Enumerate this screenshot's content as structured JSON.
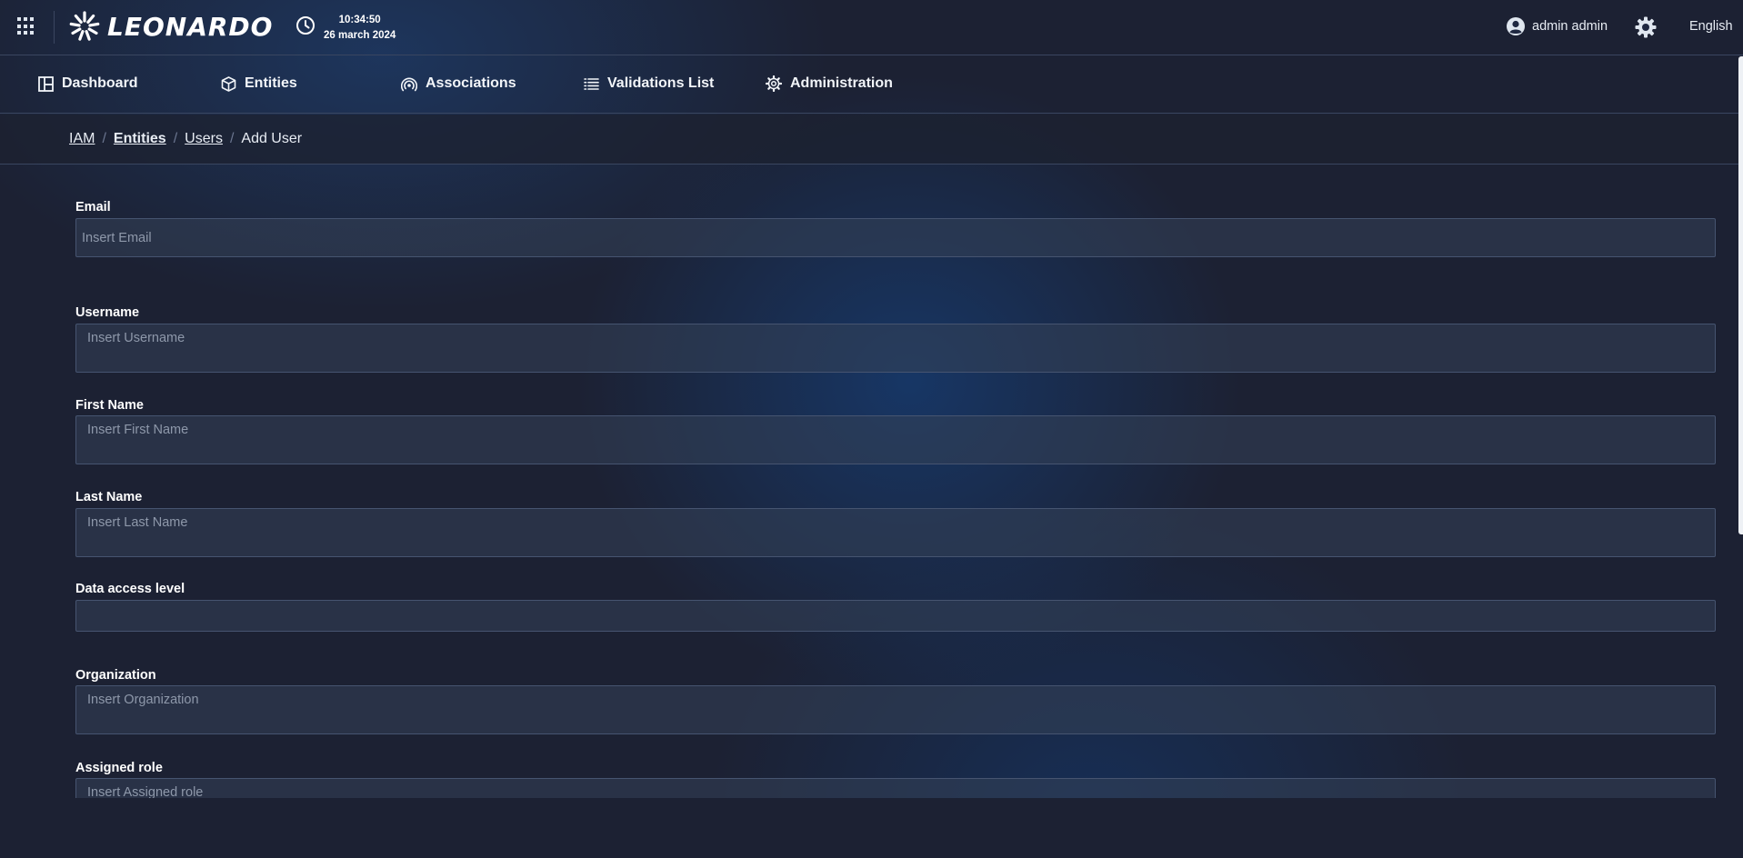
{
  "header": {
    "logo_text": "LEONARDO",
    "time": "10:34:50",
    "date": "26 march 2024",
    "user_name": "admin admin",
    "language": "English"
  },
  "nav": {
    "items": [
      {
        "label": "Dashboard",
        "icon": "dashboard-icon"
      },
      {
        "label": "Entities",
        "icon": "cube-icon"
      },
      {
        "label": "Associations",
        "icon": "broadcast-icon"
      },
      {
        "label": "Validations List",
        "icon": "list-icon"
      },
      {
        "label": "Administration",
        "icon": "gear-icon"
      }
    ]
  },
  "breadcrumb": {
    "items": [
      "IAM",
      "Entities",
      "Users",
      "Add User"
    ]
  },
  "form": {
    "email": {
      "label": "Email",
      "placeholder": "Insert Email",
      "value": ""
    },
    "username": {
      "label": "Username",
      "placeholder": "Insert Username",
      "value": ""
    },
    "first_name": {
      "label": "First Name",
      "placeholder": "Insert First Name",
      "value": ""
    },
    "last_name": {
      "label": "Last Name",
      "placeholder": "Insert Last Name",
      "value": ""
    },
    "data_access_level": {
      "label": "Data access level",
      "placeholder": "",
      "value": ""
    },
    "organization": {
      "label": "Organization",
      "placeholder": "Insert Organization",
      "value": ""
    },
    "assigned_role": {
      "label": "Assigned role",
      "placeholder": "Insert Assigned role",
      "value": ""
    }
  },
  "colors": {
    "background": "#1c2133",
    "accent_glow": "#163a6e",
    "input_background": "#344258",
    "border": "#3a4660"
  }
}
